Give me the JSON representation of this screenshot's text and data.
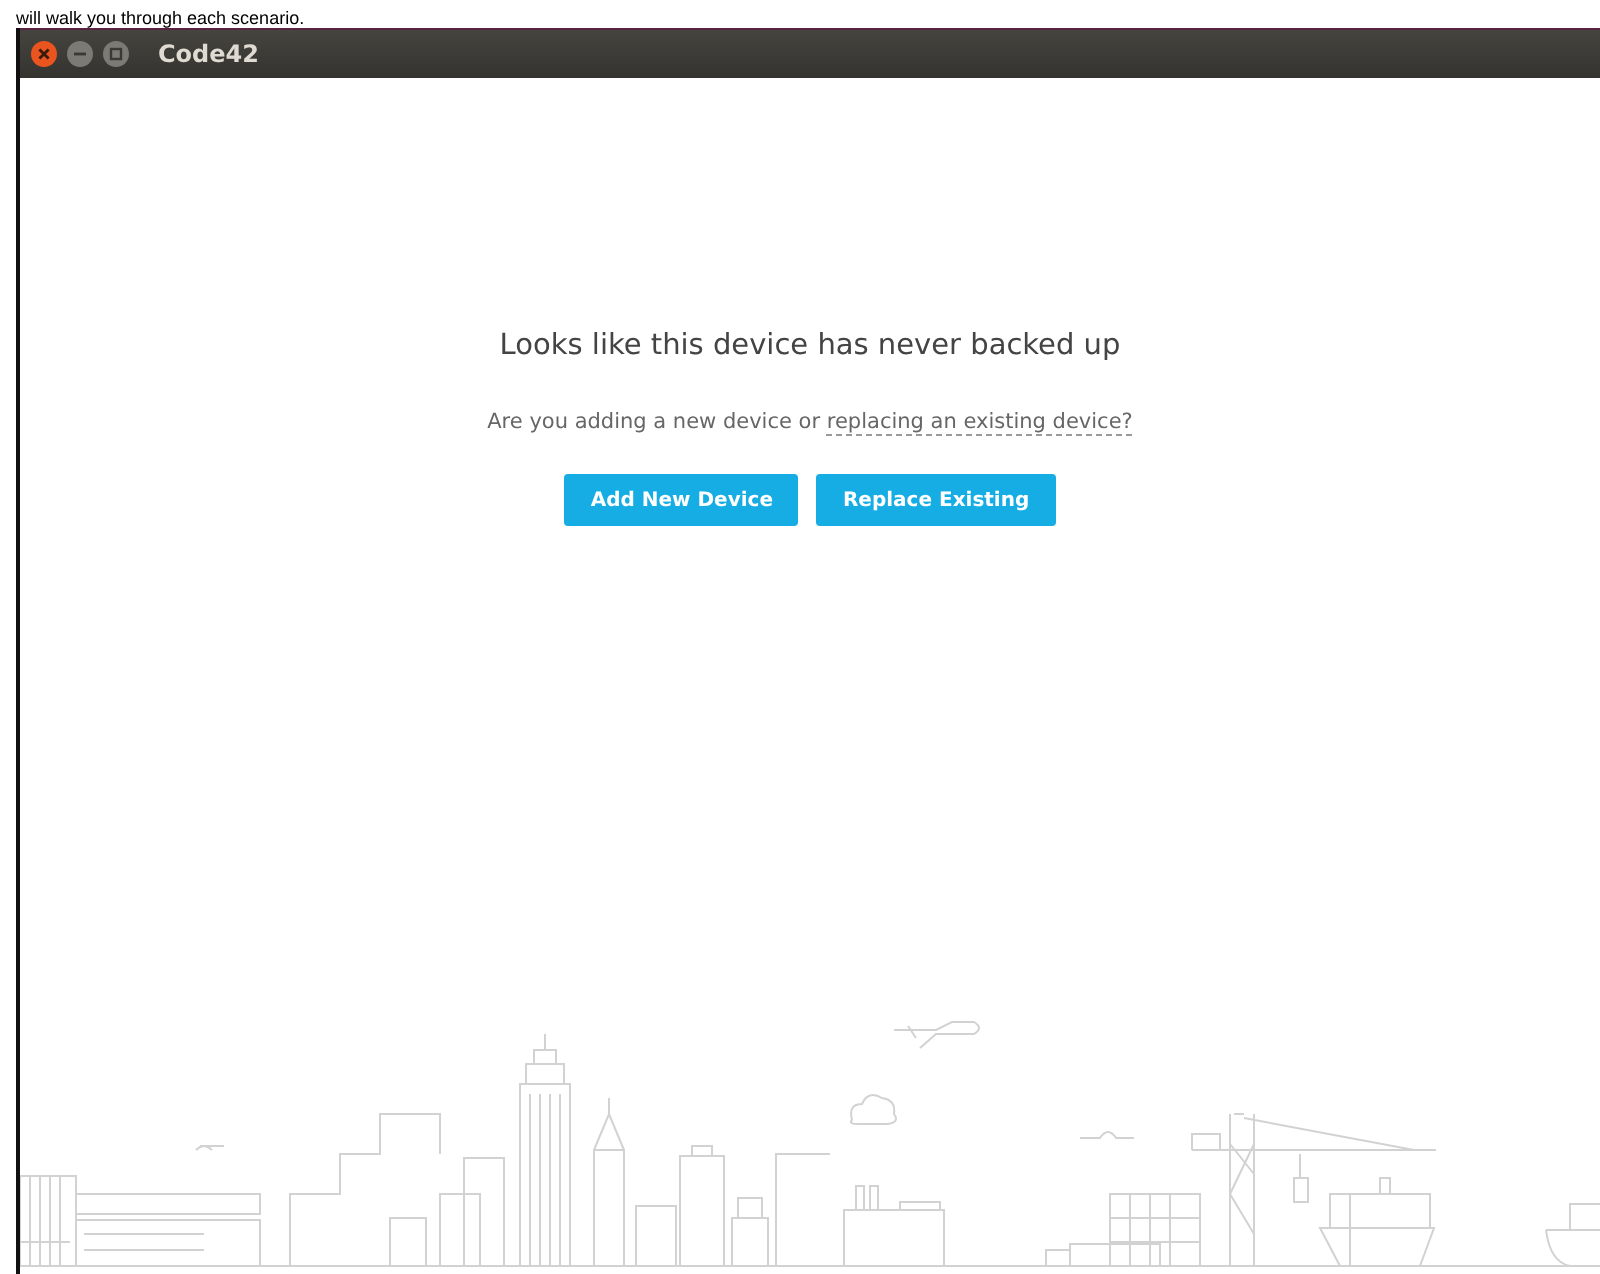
{
  "page_text": "will walk you through each scenario.",
  "window": {
    "title": "Code42"
  },
  "heading": "Looks like this device has never backed up",
  "question": {
    "text": "Are you adding a new device or ",
    "link": "replacing an existing device?"
  },
  "buttons": [
    "Add New Device",
    "Replace Existing"
  ]
}
